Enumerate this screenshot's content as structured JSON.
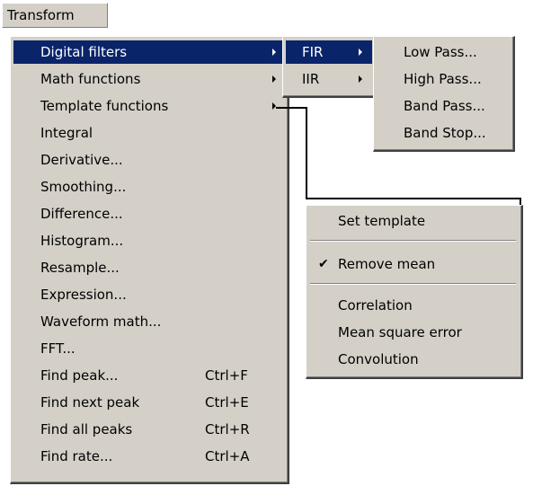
{
  "menubar": {
    "label": "Transform"
  },
  "main_menu": {
    "items": [
      {
        "label": "Digital filters",
        "shortcut": "",
        "submenu": true,
        "selected": true
      },
      {
        "label": "Math functions",
        "shortcut": "",
        "submenu": true,
        "selected": false
      },
      {
        "label": "Template functions",
        "shortcut": "",
        "submenu": true,
        "selected": false
      },
      {
        "label": "Integral",
        "shortcut": "",
        "submenu": false,
        "selected": false
      },
      {
        "label": "Derivative...",
        "shortcut": "",
        "submenu": false,
        "selected": false
      },
      {
        "label": "Smoothing...",
        "shortcut": "",
        "submenu": false,
        "selected": false
      },
      {
        "label": "Difference...",
        "shortcut": "",
        "submenu": false,
        "selected": false
      },
      {
        "label": "Histogram...",
        "shortcut": "",
        "submenu": false,
        "selected": false
      },
      {
        "label": "Resample...",
        "shortcut": "",
        "submenu": false,
        "selected": false
      },
      {
        "label": "Expression...",
        "shortcut": "",
        "submenu": false,
        "selected": false
      },
      {
        "label": "Waveform math...",
        "shortcut": "",
        "submenu": false,
        "selected": false
      },
      {
        "label": "FFT...",
        "shortcut": "",
        "submenu": false,
        "selected": false
      },
      {
        "label": "Find peak...",
        "shortcut": "Ctrl+F",
        "submenu": false,
        "selected": false
      },
      {
        "label": "Find next peak",
        "shortcut": "Ctrl+E",
        "submenu": false,
        "selected": false
      },
      {
        "label": "Find all peaks",
        "shortcut": "Ctrl+R",
        "submenu": false,
        "selected": false
      },
      {
        "label": "Find rate...",
        "shortcut": "Ctrl+A",
        "submenu": false,
        "selected": false
      }
    ]
  },
  "filter_menu": {
    "items": [
      {
        "label": "FIR",
        "selected": true
      },
      {
        "label": "IIR",
        "selected": false
      }
    ]
  },
  "fir_menu": {
    "items": [
      {
        "label": "Low Pass..."
      },
      {
        "label": "High Pass..."
      },
      {
        "label": "Band Pass..."
      },
      {
        "label": "Band Stop..."
      }
    ]
  },
  "template_menu": {
    "set_template": "Set template",
    "remove_mean": "Remove mean",
    "remove_mean_checked": true,
    "correlation": "Correlation",
    "mse": "Mean square error",
    "convolution": "Convolution"
  },
  "colors": {
    "menu_bg": "#d4d0c8",
    "highlight": "#0a246a",
    "highlight_text": "#ffffff"
  }
}
